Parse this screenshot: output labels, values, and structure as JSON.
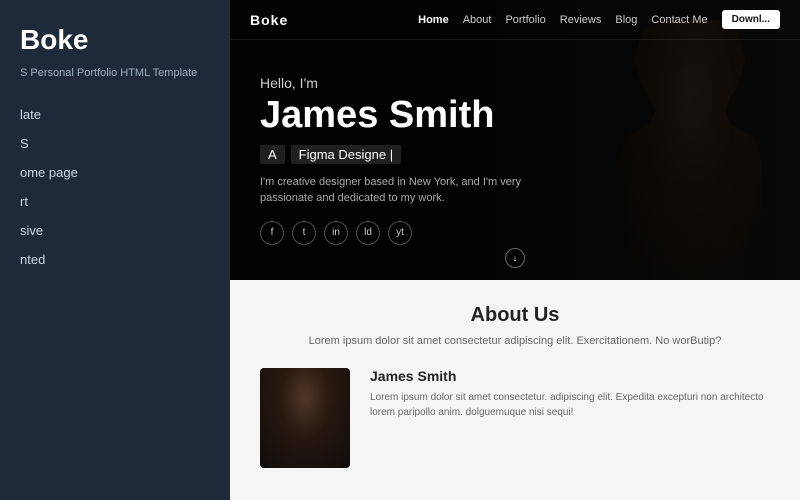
{
  "sidebar": {
    "logo": "Boke",
    "subtitle": "S Personal Portfolio HTML Template",
    "items": [
      {
        "label": "late",
        "id": "item-1"
      },
      {
        "label": "S",
        "id": "item-2"
      },
      {
        "label": "ome page",
        "id": "item-3"
      },
      {
        "label": "rt",
        "id": "item-4"
      },
      {
        "label": "sive",
        "id": "item-5"
      },
      {
        "label": "nted",
        "id": "item-6"
      }
    ]
  },
  "navbar": {
    "brand": "Boke",
    "links": [
      {
        "label": "Home",
        "active": true
      },
      {
        "label": "About",
        "active": false
      },
      {
        "label": "Portfolio",
        "active": false
      },
      {
        "label": "Reviews",
        "active": false
      },
      {
        "label": "Blog",
        "active": false
      },
      {
        "label": "Contact Me",
        "active": false
      }
    ],
    "button_label": "Downl..."
  },
  "hero": {
    "hello": "Hello, I'm",
    "name": "James Smith",
    "role_prefix": "A",
    "role": "Figma Designe |",
    "description": "I'm creative designer based in New York, and I'm very passionate and dedicated to my work.",
    "social_icons": [
      "f",
      "t",
      "in",
      "ld",
      "yt"
    ]
  },
  "about": {
    "title": "About Us",
    "description": "Lorem ipsum dolor sit amet consectetur adipiscing elit. Exercitationem. No worButip?",
    "person_name": "James Smith",
    "person_description": "Lorem ipsum dolor sit amet consectetur. adipiscing elit. Expedita excepturi non architecto lorem paripollo anim. dolguemuque nisi  sequi!"
  }
}
